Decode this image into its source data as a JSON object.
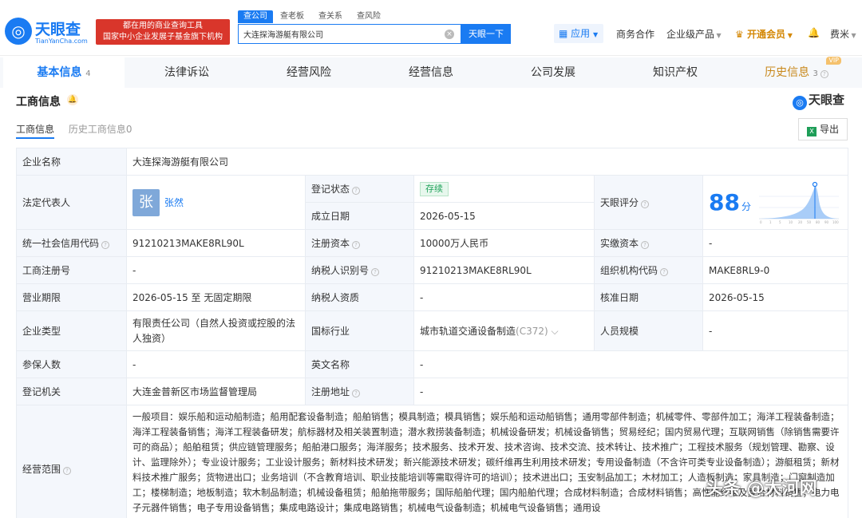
{
  "header": {
    "logo_cn": "天眼查",
    "logo_en": "TianYanCha.com",
    "promo_line1": "都在用的商业查询工具",
    "promo_line2": "国家中小企业发展子基金旗下机构",
    "search_tabs": [
      "查公司",
      "查老板",
      "查关系",
      "查风险"
    ],
    "search_value": "大连探海游艇有限公司",
    "search_button": "天眼一下",
    "apps": "应用",
    "nav": [
      "商务合作",
      "企业级产品",
      "开通会员",
      "费米"
    ]
  },
  "main_tabs": [
    {
      "label": "基本信息",
      "count": "4"
    },
    {
      "label": "法律诉讼",
      "count": ""
    },
    {
      "label": "经营风险",
      "count": ""
    },
    {
      "label": "经营信息",
      "count": ""
    },
    {
      "label": "公司发展",
      "count": ""
    },
    {
      "label": "知识产权",
      "count": ""
    },
    {
      "label": "历史信息",
      "count": "3"
    }
  ],
  "vip_tag": "VIP",
  "section": {
    "title": "工商信息",
    "brand": "天眼查",
    "sub_tabs": [
      "工商信息",
      "历史工商信息0"
    ],
    "export": "导出"
  },
  "company": {
    "name_label": "企业名称",
    "name": "大连探海游艇有限公司",
    "legal_label": "法定代表人",
    "legal_avatar": "张",
    "legal_name": "张然",
    "reg_status_label": "登记状态",
    "reg_status": "存续",
    "found_date_label": "成立日期",
    "found_date": "2026-05-15",
    "score_label": "天眼评分",
    "score": "88",
    "score_unit": "分",
    "credit_code_label": "统一社会信用代码",
    "credit_code": "91210213MAKE8RL90L",
    "reg_capital_label": "注册资本",
    "reg_capital": "10000万人民币",
    "paid_capital_label": "实缴资本",
    "paid_capital": "-",
    "biz_reg_no_label": "工商注册号",
    "biz_reg_no": "-",
    "taxpayer_id_label": "纳税人识别号",
    "taxpayer_id": "91210213MAKE8RL90L",
    "org_code_label": "组织机构代码",
    "org_code": "MAKE8RL9-0",
    "term_label": "营业期限",
    "term": "2026-05-15 至 无固定期限",
    "taxpayer_qual_label": "纳税人资质",
    "taxpayer_qual": "-",
    "approve_date_label": "核准日期",
    "approve_date": "2026-05-15",
    "type_label": "企业类型",
    "type": "有限责任公司（自然人投资或控股的法人独资）",
    "industry_label": "国标行业",
    "industry": "城市轨道交通设备制造",
    "industry_code": "(C372)",
    "staff_size_label": "人员规模",
    "staff_size": "-",
    "insured_label": "参保人数",
    "insured": "-",
    "en_name_label": "英文名称",
    "en_name": "-",
    "authority_label": "登记机关",
    "authority": "大连金普新区市场监督管理局",
    "reg_address_label": "注册地址",
    "reg_address": "-",
    "scope_label": "经营范围",
    "scope": "一般项目：娱乐船和运动船制造；船用配套设备制造；船舶销售；模具制造；模具销售；娱乐船和运动船销售；通用零部件制造；机械零件、零部件加工；海洋工程装备制造；海洋工程装备销售；海洋工程装备研发；航标器材及相关装置制造；潜水救捞装备制造；机械设备研发；机械设备销售；贸易经纪；国内贸易代理；互联网销售（除销售需要许可的商品）；船舶租赁；供应链管理服务；船舶港口服务；海洋服务；技术服务、技术开发、技术咨询、技术交流、技术转让、技术推广；工程技术服务（规划管理、勘察、设计、监理除外）；专业设计服务；工业设计服务；新材料技术研发；新兴能源技术研发；碳纤维再生利用技术研发；专用设备制造（不含许可类专业设备制造）；游艇租赁；新材料技术推广服务；货物进出口；业务培训（不含教育培训、职业技能培训等需取得许可的培训）；技术进出口；玉安制品加工；木材加工；人造板制造；家具制造；门窗制造加工；楼梯制造；地板制造；软木制品制造；机械设备租赁；船舶拖带服务；国际船舶代理；国内船舶代理；合成材料制造；合成材料销售；高性能纤维及复合材料销售；电力电子元器件销售；电子专用设备销售；集成电路设计；集成电路销售；机械电气设备制造；机械电气设备销售；通用设"
  },
  "watermark": "头条 @大河网"
}
